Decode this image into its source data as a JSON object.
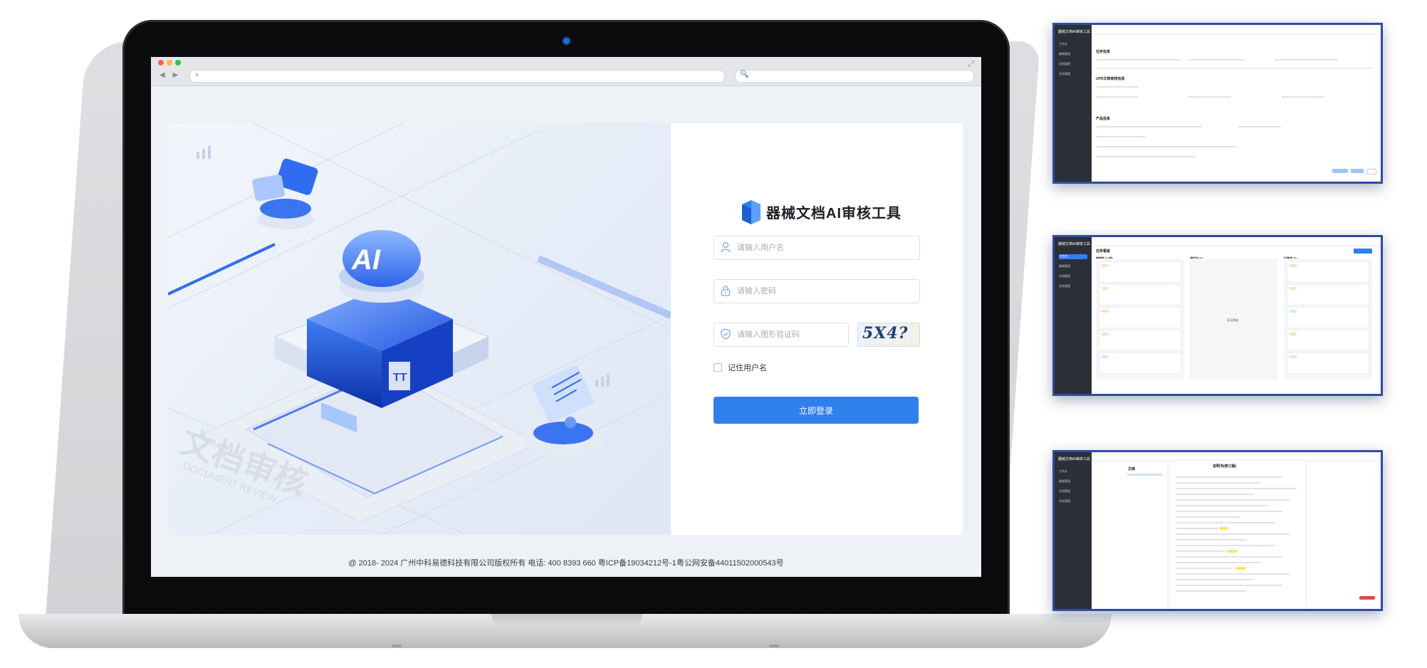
{
  "browser": {
    "nav_arrows": "◀ ▶",
    "url_plus": "+",
    "search_icon": "🔍",
    "expand_icon": "⤢",
    "traffic_lights": [
      "#ff5f57",
      "#febc2e",
      "#28c840"
    ]
  },
  "login": {
    "brand_title": "器械文档AI审核工具",
    "username_placeholder": "请输入用户名",
    "password_placeholder": "请输入密码",
    "captcha_placeholder": "请输入图形验证码",
    "captcha_text": "5X4?",
    "remember_label": "记住用户名",
    "login_button": "立即登录"
  },
  "illustration": {
    "badge_text": "AI",
    "embossed_title": "文档审核",
    "embossed_subtitle": "DOCUMENT REVIEW"
  },
  "footer": {
    "copyright": "@ 2018- 2024 广州中科易德科技有限公司版权所有 电话: 400 8393 660 粤ICP备19034212号-1粤公网安备44011502000543号"
  },
  "thumbnails": {
    "app_name": "器械文档AI审核工具",
    "sidebar_items": [
      "工作台",
      "器械管理",
      "文档管理",
      "任务管理"
    ],
    "thumb1": {
      "section1": "任务信息",
      "section2": "UPD文档审核信息",
      "section3": "产品信息"
    },
    "thumb2": {
      "title": "任务看板",
      "columns": [
        "待审核 (10条)",
        "进行中 (0)",
        "已完成 (8)"
      ],
      "empty": "暂无数据"
    },
    "thumb3": {
      "panel_title": "文档",
      "doc_title": "说明书(修订版)"
    }
  },
  "colors": {
    "accent": "#2f80ed",
    "sidebar_dark": "#2b2f38",
    "thumb_border": "#2d4da0"
  }
}
